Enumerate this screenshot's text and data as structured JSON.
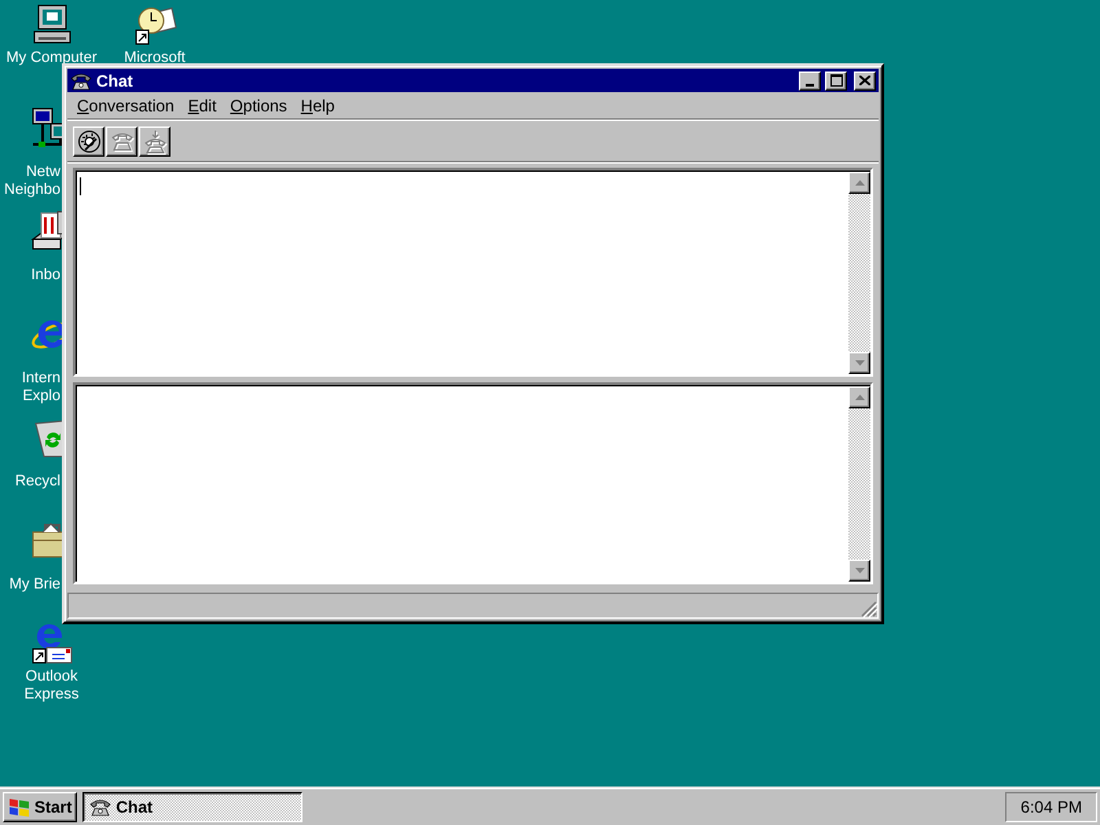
{
  "desktop_icons": [
    {
      "kind": "computer",
      "label_lines": [
        "My Computer"
      ]
    },
    {
      "kind": "network",
      "label_lines": [
        "Netw",
        "Neighbo"
      ]
    },
    {
      "kind": "inbox",
      "label_lines": [
        "Inbo"
      ]
    },
    {
      "kind": "browser",
      "label_lines": [
        "Intern",
        "Explo"
      ]
    },
    {
      "kind": "recycle",
      "label_lines": [
        "Recycl"
      ]
    },
    {
      "kind": "briefcase",
      "label_lines": [
        "My Brie"
      ]
    },
    {
      "kind": "mail",
      "label_lines": [
        "Outlook",
        "Express"
      ]
    },
    {
      "kind": "scheduler",
      "label_lines": [
        "Microsoft"
      ]
    }
  ],
  "window": {
    "title": "Chat",
    "active": true
  },
  "menu": [
    "Conversation",
    "Edit",
    "Options",
    "Help"
  ],
  "toolbar": [
    {
      "kind": "dial",
      "disabled": false
    },
    {
      "kind": "hangup",
      "disabled": true
    },
    {
      "kind": "answer",
      "disabled": true
    }
  ],
  "taskbar": {
    "start": "Start",
    "tasks": [
      {
        "label": "Chat",
        "selected": true
      }
    ],
    "clock": "6:04 PM"
  }
}
